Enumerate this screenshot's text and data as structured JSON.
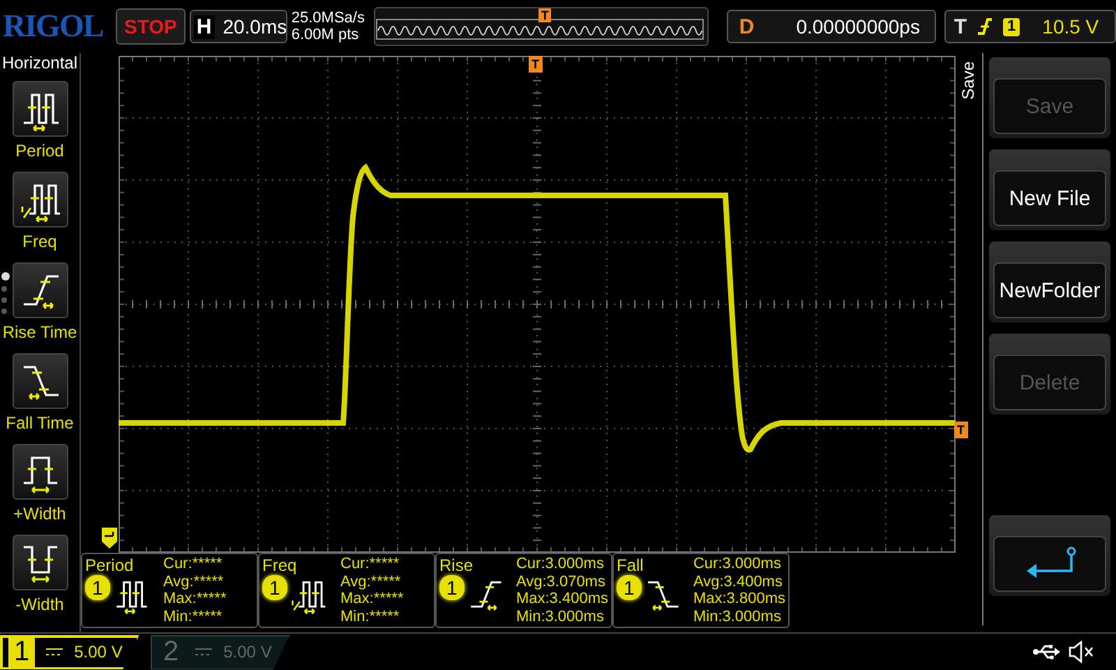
{
  "brand": "RIGOL",
  "run_state": {
    "label": "STOP",
    "kind": "stop"
  },
  "timebase": {
    "label": "H",
    "value": "20.0ms"
  },
  "acquisition": {
    "sample_rate": "25.0MSa/s",
    "memory_depth": "6.00M pts"
  },
  "delay": {
    "label": "D",
    "value": "0.00000000ps"
  },
  "trigger": {
    "label": "T",
    "kind": "rising",
    "timeline_marker": "T",
    "source": "1",
    "level": "10.5 V"
  },
  "sidebar": {
    "title": "Horizontal",
    "page_dots": [
      {
        "selected": true
      },
      {
        "selected": false
      },
      {
        "selected": false
      },
      {
        "selected": false
      }
    ],
    "items": [
      {
        "label": "Period",
        "kind": "period"
      },
      {
        "label": "Freq",
        "kind": "freq"
      },
      {
        "label": "Rise Time",
        "kind": "rise"
      },
      {
        "label": "Fall Time",
        "kind": "fall"
      },
      {
        "label": "+Width",
        "kind": "pwidth"
      },
      {
        "label": "-Width",
        "kind": "nwidth"
      }
    ]
  },
  "plot": {
    "trigger_position_marker": "T",
    "trigger_level_marker": "T"
  },
  "measurements": [
    {
      "name": "Period",
      "kind": "period",
      "channel": "1",
      "lines": [
        "Cur:*****",
        "Avg:*****",
        "Max:*****",
        "Min:*****"
      ]
    },
    {
      "name": "Freq",
      "kind": "freq",
      "channel": "1",
      "lines": [
        "Cur:*****",
        "Avg:*****",
        "Max:*****",
        "Min:*****"
      ]
    },
    {
      "name": "Rise",
      "kind": "rise",
      "channel": "1",
      "lines": [
        "Cur:3.000ms",
        "Avg:3.070ms",
        "Max:3.400ms",
        "Min:3.000ms"
      ]
    },
    {
      "name": "Fall",
      "kind": "fall",
      "channel": "1",
      "lines": [
        "Cur:3.000ms",
        "Avg:3.400ms",
        "Max:3.800ms",
        "Min:3.000ms"
      ]
    }
  ],
  "menu": {
    "title": "Save",
    "buttons": [
      {
        "kind": "text",
        "label": "Save",
        "disabled": true
      },
      {
        "kind": "text",
        "label": "New File",
        "disabled": false
      },
      {
        "kind": "text",
        "label": "NewFolder",
        "disabled": false
      },
      {
        "kind": "text",
        "label": "Delete",
        "disabled": true
      },
      {
        "kind": "back"
      }
    ]
  },
  "channels": [
    {
      "number": "1",
      "scale": "5.00 V",
      "selected": true
    },
    {
      "number": "2",
      "scale": "5.00 V",
      "selected": false
    }
  ]
}
